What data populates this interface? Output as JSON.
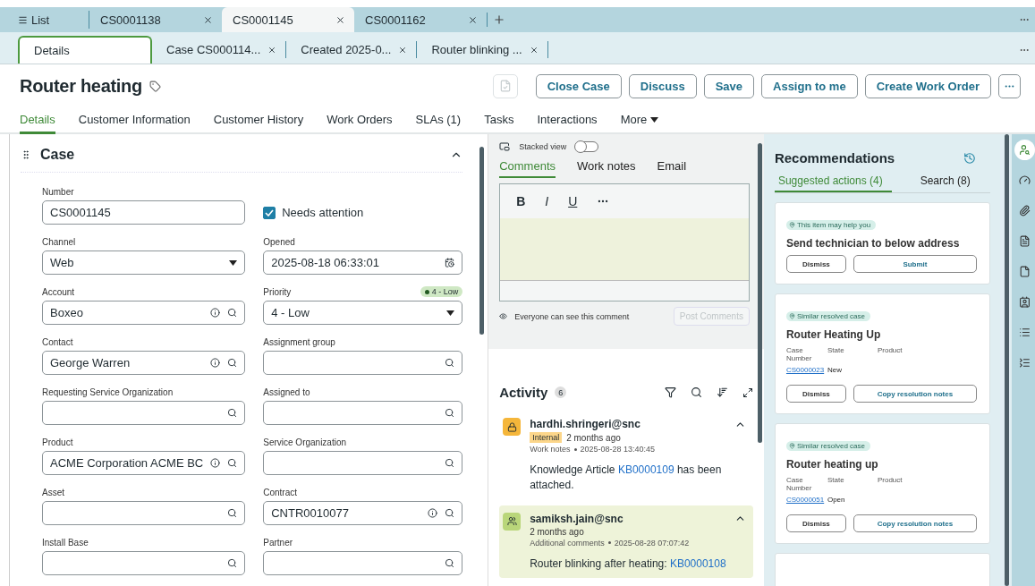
{
  "tabs": [
    {
      "label": "List",
      "kind": "list",
      "selected": false
    },
    {
      "label": "CS0001138",
      "kind": "record",
      "selected": false
    },
    {
      "label": "CS0001145",
      "kind": "record",
      "selected": true
    },
    {
      "label": "CS0001162",
      "kind": "record",
      "selected": false
    }
  ],
  "subtabs": [
    {
      "label": "Details",
      "closable": false,
      "selected": true
    },
    {
      "label": "Case CS000114...",
      "closable": true,
      "selected": false
    },
    {
      "label": "Created 2025-0...",
      "closable": true,
      "selected": false
    },
    {
      "label": "Router blinking ...",
      "closable": true,
      "selected": false
    }
  ],
  "record": {
    "title": "Router heating"
  },
  "actions": [
    {
      "kind": "icon",
      "disabled": true
    },
    {
      "kind": "text",
      "label": "Close Case",
      "disabled": false
    },
    {
      "kind": "text",
      "label": "Discuss",
      "disabled": false
    },
    {
      "kind": "text",
      "label": "Save",
      "disabled": false
    },
    {
      "kind": "text",
      "label": "Assign to me",
      "disabled": false
    },
    {
      "kind": "text",
      "label": "Create Work Order",
      "disabled": false
    },
    {
      "kind": "more",
      "disabled": false
    }
  ],
  "nav_tabs": [
    {
      "label": "Details",
      "kind": "tab",
      "selected": true
    },
    {
      "label": "Customer Information",
      "kind": "tab",
      "selected": false
    },
    {
      "label": "Customer History",
      "kind": "tab",
      "selected": false
    },
    {
      "label": "Work Orders",
      "kind": "tab",
      "selected": false
    },
    {
      "label": "SLAs (1)",
      "kind": "tab",
      "selected": false
    },
    {
      "label": "Tasks",
      "kind": "tab",
      "selected": false
    },
    {
      "label": "Interactions",
      "kind": "tab",
      "selected": false
    },
    {
      "label": "More",
      "kind": "menu",
      "selected": false
    }
  ],
  "case_section": {
    "title": "Case",
    "expanded": true,
    "fields": [
      {
        "kind": "text",
        "label": "Number",
        "value": "CS0001145"
      },
      {
        "kind": "checkbox",
        "label": "Needs attention",
        "checked": true
      },
      {
        "kind": "select",
        "label": "Channel",
        "value": "Web"
      },
      {
        "kind": "date",
        "label": "Opened",
        "value": "2025-08-18 06:33:01"
      },
      {
        "kind": "lookup",
        "label": "Account",
        "value": "Boxeo",
        "info": true
      },
      {
        "kind": "select",
        "label": "Priority",
        "value": "4 - Low",
        "badge": "4 - Low"
      },
      {
        "kind": "lookup",
        "label": "Contact",
        "value": "George Warren",
        "info": true
      },
      {
        "kind": "lookup",
        "label": "Assignment group",
        "info": false
      },
      {
        "kind": "lookup",
        "label": "Requesting Service Organization",
        "info": false
      },
      {
        "kind": "lookup",
        "label": "Assigned to",
        "info": false
      },
      {
        "kind": "lookup",
        "label": "Product",
        "value": "ACME Corporation ACME BC",
        "info": true
      },
      {
        "kind": "lookup",
        "label": "Service Organization",
        "info": false
      },
      {
        "kind": "lookup",
        "label": "Asset",
        "info": false
      },
      {
        "kind": "lookup",
        "label": "Contract",
        "value": "CNTR0010077",
        "info": true
      },
      {
        "kind": "lookup",
        "label": "Install Base",
        "info": false
      },
      {
        "kind": "lookup",
        "label": "Partner",
        "info": false
      }
    ]
  },
  "composer": {
    "stacked_view": {
      "label": "Stacked view",
      "on": false
    },
    "tabs": [
      {
        "label": "Comments",
        "selected": true
      },
      {
        "label": "Work notes",
        "selected": false
      },
      {
        "label": "Email",
        "selected": false
      }
    ],
    "toolbar": [
      {
        "kind": "bold",
        "label": "B"
      },
      {
        "kind": "italic",
        "label": "I"
      },
      {
        "kind": "underline",
        "label": "U"
      },
      {
        "kind": "more"
      }
    ],
    "visibility_note": "Everyone can see this comment",
    "post_button": {
      "label": "Post Comments",
      "disabled": true
    }
  },
  "activity": {
    "title": "Activity",
    "count": "6",
    "entries": [
      {
        "kind": "work_note",
        "author": "hardhi.shringeri@snc",
        "badge": "Internal",
        "time": "2 months ago",
        "type": "Work notes",
        "timestamp": "2025-08-28 13:40:45",
        "body_before": "Knowledge Article ",
        "link": "KB0000109",
        "body_after": " has been attached.",
        "expanded": true
      },
      {
        "kind": "comment",
        "author": "samiksh.jain@snc",
        "time": "2 months ago",
        "type": "Additional comments",
        "timestamp": "2025-08-28 07:07:42",
        "body_before": "Router blinking after heating: ",
        "link": "KB0000108",
        "expanded": true
      }
    ]
  },
  "recommendations": {
    "title": "Recommendations",
    "tabs": [
      {
        "label": "Suggested actions (4)",
        "selected": true
      },
      {
        "label": "Search (8)",
        "selected": false
      }
    ],
    "cards": [
      {
        "kind": "action",
        "tag": "This item may help you",
        "title": "Send technician to below address",
        "buttons": [
          "Dismiss",
          "Submit"
        ]
      },
      {
        "kind": "case",
        "tag": "Similar resolved case",
        "title": "Router Heating Up",
        "columns": [
          "Case Number",
          "State",
          "Product"
        ],
        "case_number": "CS0000023",
        "state": "New",
        "buttons": [
          "Dismiss",
          "Copy resolution notes"
        ]
      },
      {
        "kind": "case",
        "tag": "Similar resolved case",
        "title": "Router heating up",
        "columns": [
          "Case Number",
          "State",
          "Product"
        ],
        "case_number": "CS0000051",
        "state": "Open",
        "buttons": [
          "Dismiss",
          "Copy resolution notes"
        ]
      },
      {
        "kind": "stub"
      }
    ]
  },
  "rail": [
    {
      "selected": true
    },
    {
      "selected": false
    },
    {
      "selected": false
    },
    {
      "selected": false
    },
    {
      "selected": false
    },
    {
      "selected": false
    },
    {
      "selected": false
    },
    {
      "selected": false
    }
  ]
}
